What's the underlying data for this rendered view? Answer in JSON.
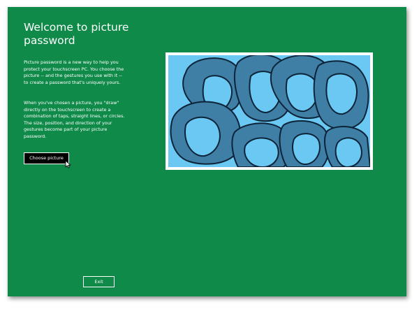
{
  "page": {
    "title": "Welcome to picture password",
    "paragraph_1": "Picture password is a new way to help you protect your touchscreen PC. You choose the picture -- and the gestures you use with it -- to create a password that's uniquely yours.",
    "paragraph_2": "When you've chosen a picture, you \"draw\" directly on the touchscreen to create a combination of taps, straight lines, or circles. The size, position, and direction of your gestures become part of your picture password."
  },
  "buttons": {
    "choose_label": "Choose picture",
    "exit_label": "Exit"
  },
  "icons": {
    "cursor": "mouse-pointer-icon"
  },
  "colors": {
    "background": "#0f8a48",
    "text": "#ffffff",
    "button_fill": "#000000",
    "picture_light_blue": "#6ac8f2",
    "picture_mid_blue": "#3f7fa6",
    "picture_outline": "#0d2338"
  }
}
